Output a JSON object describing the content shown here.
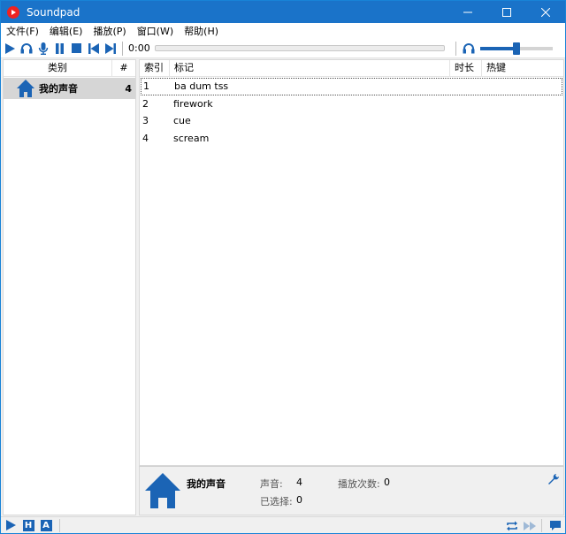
{
  "window": {
    "title": "Soundpad",
    "minimize_glyph": "—",
    "maximize_glyph": "☐",
    "close_glyph": "✕"
  },
  "menu": [
    {
      "label": "文件(F)"
    },
    {
      "label": "编辑(E)"
    },
    {
      "label": "播放(P)"
    },
    {
      "label": "窗口(W)"
    },
    {
      "label": "帮助(H)"
    }
  ],
  "toolbar": {
    "time": "0:00",
    "volume_level": 0.5
  },
  "categories": {
    "header_category": "类别",
    "header_count": "#",
    "items": [
      {
        "label": "我的声音",
        "count": "4"
      }
    ]
  },
  "sounds": {
    "headers": {
      "index": "索引",
      "tag": "标记",
      "duration": "时长",
      "hotkey": "热键"
    },
    "rows": [
      {
        "index": "1",
        "tag": "ba dum tss"
      },
      {
        "index": "2",
        "tag": "firework"
      },
      {
        "index": "3",
        "tag": "cue"
      },
      {
        "index": "4",
        "tag": "scream"
      }
    ]
  },
  "info": {
    "category": "我的声音",
    "sounds_label": "声音:",
    "sounds_value": "4",
    "selected_label": "已选择:",
    "selected_value": "0",
    "plays_label": "播放次数:",
    "plays_value": "0"
  },
  "statusbar": {
    "h_label": "H",
    "a_label": "A"
  },
  "colors": {
    "accent": "#1b64b5",
    "titlebar": "#1a73c9"
  }
}
